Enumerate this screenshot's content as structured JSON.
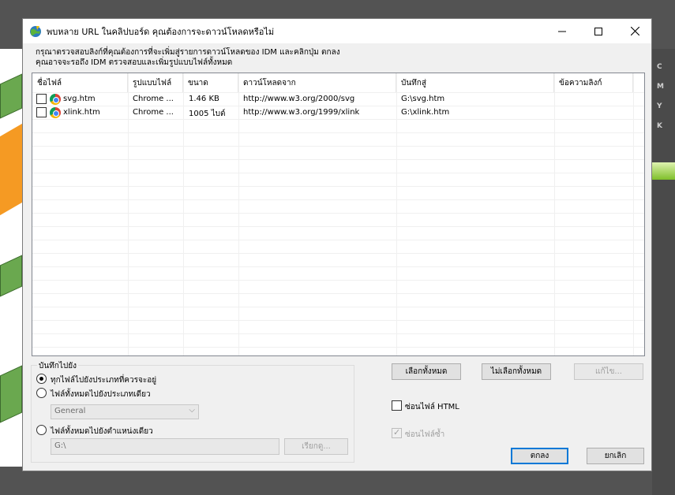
{
  "background": {
    "cmyk_labels": [
      "C",
      "M",
      "Y",
      "K"
    ]
  },
  "dialog": {
    "title": "พบหลาย URL ในคลิปบอร์ด คุณต้องการจะดาวน์โหลดหรือไม่",
    "icons": {
      "app": "idm-globe-icon",
      "minimize": "minimize-icon",
      "maximize": "maximize-icon",
      "close": "close-icon"
    },
    "instructions": {
      "line1": "กรุณาตรวจสอบลิงก์ที่คุณต้องการที่จะเพิ่มสู่รายการดาวน์โหลดของ IDM และคลิกปุ่ม ตกลง",
      "line2": "คุณอาจจะรอถึง IDM ตรวจสอบและเพิ่มรูปแบบไฟล์ทั้งหมด"
    },
    "table": {
      "columns": [
        "ชื่อไฟล์",
        "รูปแบบไฟล์",
        "ขนาด",
        "ดาวน์โหลดจาก",
        "บันทึกสู่",
        "ข้อความลิงก์"
      ],
      "rows": [
        {
          "checked": false,
          "icon": "chrome-icon",
          "name": "svg.htm",
          "type": "Chrome ...",
          "size": "1.46  KB",
          "from": "http://www.w3.org/2000/svg",
          "save_to": "G:\\svg.htm",
          "link_text": ""
        },
        {
          "checked": false,
          "icon": "chrome-icon",
          "name": "xlink.htm",
          "type": "Chrome ...",
          "size": "1005  ไบต์",
          "from": "http://www.w3.org/1999/xlink",
          "save_to": "G:\\xlink.htm",
          "link_text": ""
        }
      ]
    },
    "save_group": {
      "label": "บันทึกไปยัง",
      "option1": "ทุกไฟล์ไปยังประเภทที่ควรจะอยู่",
      "option2": "ไฟล์ทั้งหมดไปยังประเภทเดียว",
      "option3": "ไฟล์ทั้งหมดไปยังตำแหน่งเดียว",
      "selected": "option1",
      "category_value": "General",
      "path_value": "G:\\",
      "browse_label": "เรียกดู..."
    },
    "buttons": {
      "select_all": "เลือกทั้งหมด",
      "deselect_all": "ไม่เลือกทั้งหมด",
      "edit": "แก้ไข...",
      "ok": "ตกลง",
      "cancel": "ยกเลิก"
    },
    "checkboxes": {
      "hide_html": {
        "label": "ซ่อนไฟล์ HTML",
        "checked": false,
        "enabled": true
      },
      "hide_duplicates": {
        "label": "ซ่อนไฟล์ซ้ำ",
        "checked": true,
        "enabled": false
      }
    }
  }
}
